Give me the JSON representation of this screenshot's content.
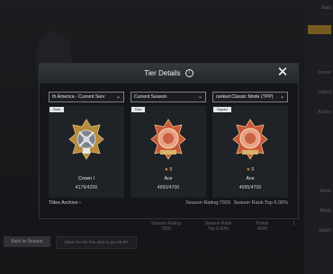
{
  "background": {
    "right_panel_items": [
      "Stats",
      "",
      "Career",
      "Collect",
      "Achiev",
      "Career",
      "",
      "",
      "Mode",
      "Mode",
      "Play",
      "Match"
    ],
    "bottom_button": "Back to Season",
    "bottom_tab": "Share for the free item to get 20 BP",
    "bottom_stats": [
      {
        "label": "Season Rating",
        "value": "7929"
      },
      {
        "label": "Season Rank",
        "value": "Top 6.00%"
      },
      {
        "label": "Points",
        "value": "4095"
      },
      {
        "label": "",
        "value": "1"
      }
    ]
  },
  "modal": {
    "title": "Tier Details",
    "close_label": "✕",
    "info_icon": "i",
    "dropdowns": [
      {
        "value": "th America - Current Serv"
      },
      {
        "value": "Current Season"
      },
      {
        "value": "ranked Classic Mode (TPP)"
      }
    ],
    "cards": [
      {
        "tag": "Solo",
        "stars": "",
        "tier": "Crown I",
        "points": "4179/4200",
        "medal": "crown"
      },
      {
        "tag": "Duo",
        "stars": "5",
        "tier": "Ace",
        "points": "4650/4700",
        "medal": "ace"
      },
      {
        "tag": "Squad",
        "stars": "5",
        "tier": "Ace",
        "points": "4995/4700",
        "medal": "ace"
      }
    ],
    "footer": {
      "archive": "Titles Archive",
      "archive_chevron": "›",
      "season_rating": "Season Rating:7929",
      "season_rank": "Season Rank:Top 6.00%"
    }
  }
}
